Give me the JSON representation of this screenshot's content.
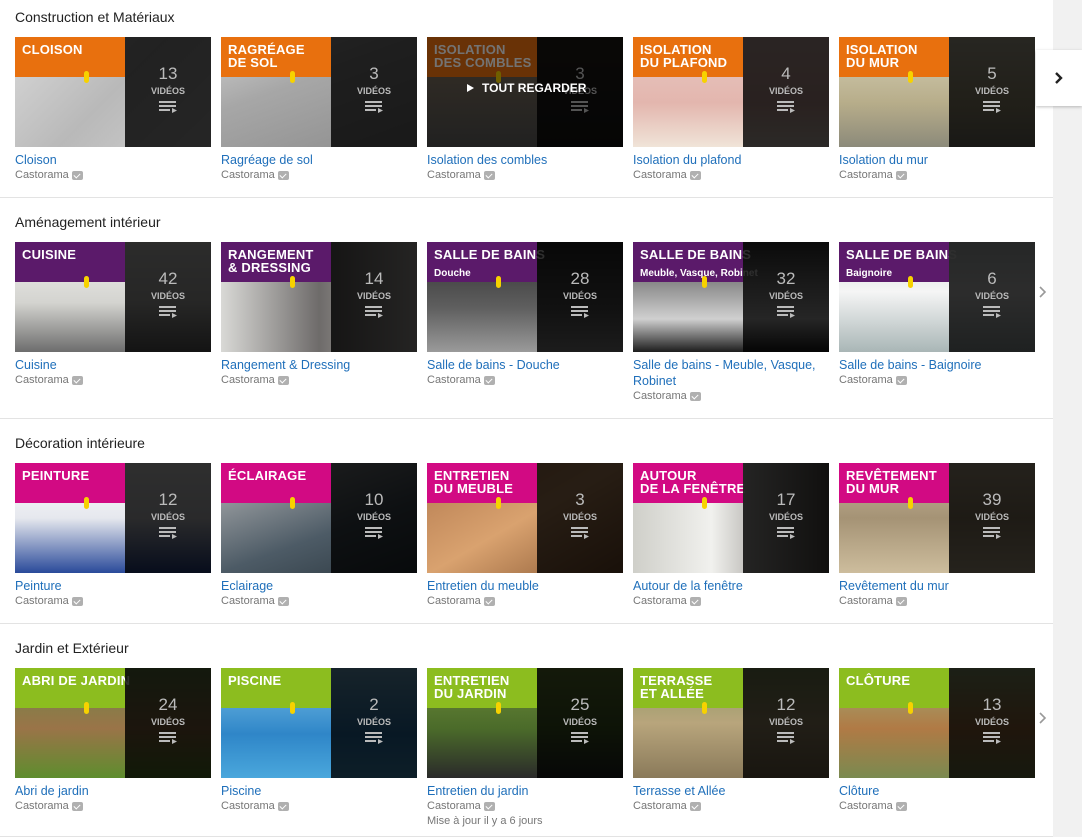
{
  "colors": {
    "orange": "#e8700e",
    "purple": "#5b1a6a",
    "pink": "#d20a83",
    "green": "#8cbd1f",
    "link": "#1f6fba"
  },
  "icons": {
    "next": "chevron-right-icon",
    "playlist": "playlist-icon",
    "play": "play-icon",
    "verified": "verified-check-icon"
  },
  "sections": [
    {
      "title": "Construction et Matériaux",
      "color": "orange",
      "cards": [
        {
          "banner": "CLOISON",
          "sub": "",
          "count": "13",
          "label": "VIDÉOS",
          "title": "Cloison",
          "channel": "Castorama",
          "photo": "concrete"
        },
        {
          "banner": "RAGRÉAGE\nDE SOL",
          "sub": "",
          "count": "3",
          "label": "VIDÉOS",
          "title": "Ragréage de sol",
          "channel": "Castorama",
          "photo": "screed"
        },
        {
          "banner": "ISOLATION\nDES COMBLES",
          "sub": "",
          "count": "3",
          "label": "VIDÉOS",
          "title": "Isolation des combles",
          "channel": "Castorama",
          "photo": "attic",
          "hover": "TOUT REGARDER"
        },
        {
          "banner": "ISOLATION\nDU PLAFOND",
          "sub": "",
          "count": "4",
          "label": "VIDÉOS",
          "title": "Isolation du plafond",
          "channel": "Castorama",
          "photo": "ceiling"
        },
        {
          "banner": "ISOLATION\nDU MUR",
          "sub": "",
          "count": "5",
          "label": "VIDÉOS",
          "title": "Isolation du mur",
          "channel": "Castorama",
          "photo": "wall"
        }
      ]
    },
    {
      "title": "Aménagement intérieur",
      "color": "purple",
      "cards": [
        {
          "banner": "CUISINE",
          "sub": "",
          "count": "42",
          "label": "VIDÉOS",
          "title": "Cuisine",
          "channel": "Castorama",
          "photo": "kitchen"
        },
        {
          "banner": "RANGEMENT\n& DRESSING",
          "sub": "",
          "count": "14",
          "label": "VIDÉOS",
          "title": "Rangement & Dressing",
          "channel": "Castorama",
          "photo": "dressing"
        },
        {
          "banner": "SALLE DE BAINS",
          "sub": "Douche",
          "count": "28",
          "label": "VIDÉOS",
          "title": "Salle de bains - Douche",
          "channel": "Castorama",
          "photo": "shower"
        },
        {
          "banner": "SALLE DE BAINS",
          "sub": "Meuble, Vasque, Robinet",
          "count": "32",
          "label": "VIDÉOS",
          "title": "Salle de bains - Meuble, Vasque, Robinet",
          "channel": "Castorama",
          "photo": "basin"
        },
        {
          "banner": "SALLE DE BAINS",
          "sub": "Baignoire",
          "count": "6",
          "label": "VIDÉOS",
          "title": "Salle de bains - Baignoire",
          "channel": "Castorama",
          "photo": "bath"
        }
      ]
    },
    {
      "title": "Décoration intérieure",
      "color": "pink",
      "cards": [
        {
          "banner": "PEINTURE",
          "sub": "",
          "count": "12",
          "label": "VIDÉOS",
          "title": "Peinture",
          "channel": "Castorama",
          "photo": "paint"
        },
        {
          "banner": "ÉCLAIRAGE",
          "sub": "",
          "count": "10",
          "label": "VIDÉOS",
          "title": "Eclairage",
          "channel": "Castorama",
          "photo": "light"
        },
        {
          "banner": "ENTRETIEN\nDU MEUBLE",
          "sub": "",
          "count": "3",
          "label": "VIDÉOS",
          "title": "Entretien du meuble",
          "channel": "Castorama",
          "photo": "wood"
        },
        {
          "banner": "AUTOUR\nDE LA FENÊTRE",
          "sub": "",
          "count": "17",
          "label": "VIDÉOS",
          "title": "Autour de la fenêtre",
          "channel": "Castorama",
          "photo": "window"
        },
        {
          "banner": "REVÊTEMENT\nDU MUR",
          "sub": "",
          "count": "39",
          "label": "VIDÉOS",
          "title": "Revêtement du mur",
          "channel": "Castorama",
          "photo": "stone"
        }
      ]
    },
    {
      "title": "Jardin et Extérieur",
      "color": "green",
      "cards": [
        {
          "banner": "ABRI DE JARDIN",
          "sub": "",
          "count": "24",
          "label": "VIDÉOS",
          "title": "Abri de jardin",
          "channel": "Castorama",
          "photo": "shed"
        },
        {
          "banner": "PISCINE",
          "sub": "",
          "count": "2",
          "label": "VIDÉOS",
          "title": "Piscine",
          "channel": "Castorama",
          "photo": "pool"
        },
        {
          "banner": "ENTRETIEN\nDU JARDIN",
          "sub": "",
          "count": "25",
          "label": "VIDÉOS",
          "title": "Entretien du jardin",
          "channel": "Castorama",
          "photo": "lawn",
          "updated": "Mise à jour il y a 6 jours"
        },
        {
          "banner": "TERRASSE\nET ALLÉE",
          "sub": "",
          "count": "12",
          "label": "VIDÉOS",
          "title": "Terrasse et Allée",
          "channel": "Castorama",
          "photo": "deck"
        },
        {
          "banner": "CLÔTURE",
          "sub": "",
          "count": "13",
          "label": "VIDÉOS",
          "title": "Clôture",
          "channel": "Castorama",
          "photo": "fence"
        }
      ]
    }
  ]
}
